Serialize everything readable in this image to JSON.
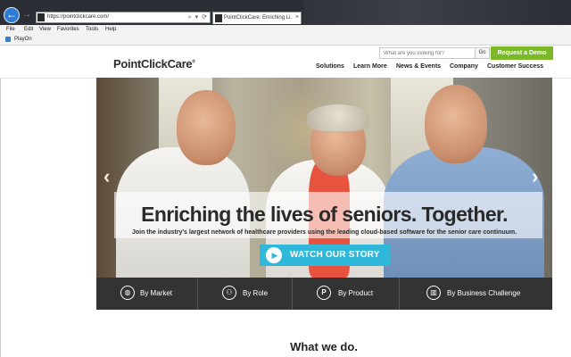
{
  "browser": {
    "url": "https://pointclickcare.com/",
    "tab_title": "PointClickCare: Enriching Li...",
    "tab_close": "×",
    "addr_tools": "⌕ ▾ ⟳",
    "back_glyph": "←",
    "forward_glyph": "→",
    "menu": [
      "File",
      "Edit",
      "View",
      "Favorites",
      "Tools",
      "Help"
    ],
    "favorites_item": "PlayOn"
  },
  "header": {
    "logo": "PointClickCare",
    "logo_mark": "®",
    "search_placeholder": "What are you looking for?",
    "search_go": "Go",
    "demo_button": "Request a Demo",
    "nav": [
      "Solutions",
      "Learn More",
      "News & Events",
      "Company",
      "Customer Success"
    ]
  },
  "hero": {
    "title": "Enriching the lives of seniors. Together.",
    "subtitle": "Join the industry's largest network of healthcare providers using the leading cloud-based software for the senior care continuum.",
    "cta": "WATCH OUR STORY",
    "prev_arrow": "‹",
    "next_arrow": "›"
  },
  "categories": [
    {
      "label": "By Market",
      "icon": "globe-icon"
    },
    {
      "label": "By Role",
      "icon": "people-icon"
    },
    {
      "label": "By Product",
      "icon": "product-icon"
    },
    {
      "label": "By Business Challenge",
      "icon": "chart-icon"
    }
  ],
  "section_heading": "What we do.",
  "colors": {
    "accent_green": "#7bb929",
    "cta_blue": "#30b8da",
    "category_bar": "#333333",
    "browser_chrome": "#2b2f35"
  }
}
